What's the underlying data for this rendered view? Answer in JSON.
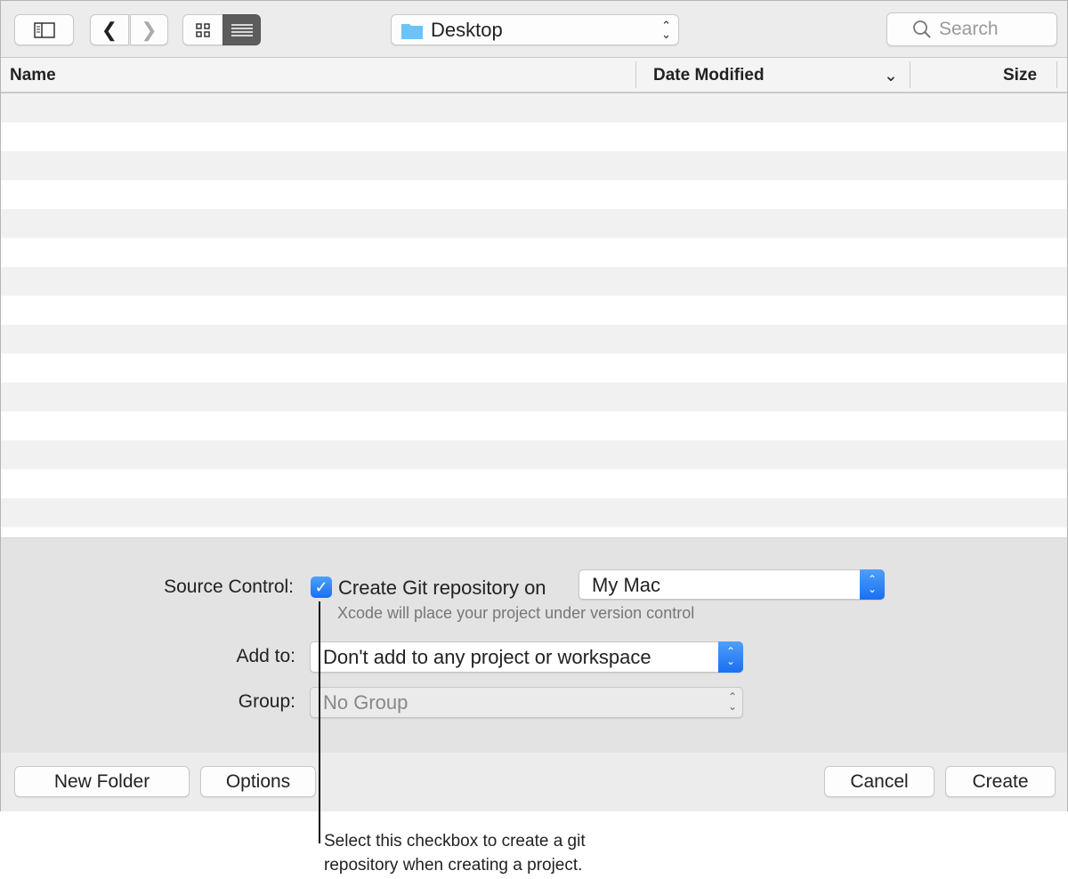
{
  "toolbar": {
    "location": "Desktop",
    "search_placeholder": "Search"
  },
  "columns": {
    "name": "Name",
    "date_modified": "Date Modified",
    "size": "Size"
  },
  "source_control": {
    "label": "Source Control:",
    "checkbox_label": "Create Git repository on",
    "checked": true,
    "location": "My Mac",
    "hint": "Xcode will place your project under version control"
  },
  "add_to": {
    "label": "Add to:",
    "value": "Don't add to any project or workspace"
  },
  "group": {
    "label": "Group:",
    "value": "No Group"
  },
  "footer": {
    "new_folder": "New Folder",
    "options": "Options",
    "cancel": "Cancel",
    "create": "Create"
  },
  "callout": {
    "line1": "Select this checkbox to create a git",
    "line2": "repository when creating a project."
  },
  "colors": {
    "accent": "#1a6ff2"
  }
}
